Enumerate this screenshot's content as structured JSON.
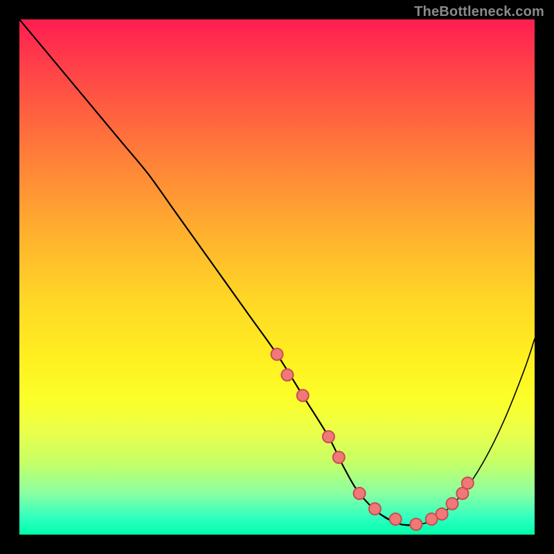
{
  "watermark": "TheBottleneck.com",
  "colors": {
    "page_bg": "#000000",
    "gradient_top": "#ff1e50",
    "gradient_bottom": "#00ffa8",
    "curve": "#000000",
    "dot_fill": "#f07878",
    "dot_stroke": "#c84e4e"
  },
  "chart_data": {
    "type": "line",
    "title": "",
    "xlabel": "",
    "ylabel": "",
    "xlim": [
      0,
      100
    ],
    "ylim": [
      0,
      100
    ],
    "series": [
      {
        "name": "bottleneck-curve",
        "x": [
          0,
          5,
          10,
          15,
          20,
          25,
          30,
          35,
          40,
          45,
          50,
          55,
          60,
          63,
          66,
          70,
          74,
          78,
          82,
          86,
          90,
          94,
          98,
          100
        ],
        "values": [
          100,
          94,
          88,
          82,
          76,
          70,
          63,
          56,
          49,
          42,
          35,
          27,
          19,
          13,
          8,
          4,
          2,
          2,
          4,
          8,
          14,
          22,
          32,
          38
        ]
      }
    ],
    "markers": {
      "name": "highlight-dots",
      "x": [
        50,
        52,
        55,
        60,
        62,
        66,
        69,
        73,
        77,
        80,
        82,
        84,
        86,
        87
      ],
      "values": [
        35,
        31,
        27,
        19,
        15,
        8,
        5,
        3,
        2,
        3,
        4,
        6,
        8,
        10
      ]
    }
  }
}
